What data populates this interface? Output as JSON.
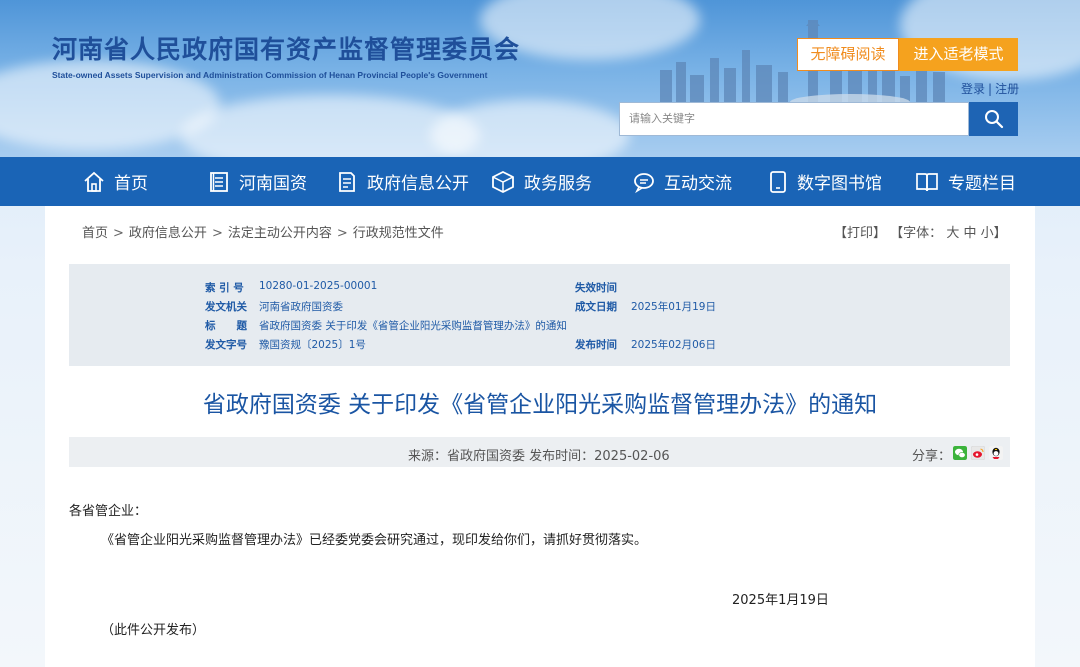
{
  "header": {
    "title": "河南省人民政府国有资产监督管理委员会",
    "subtitle": "State-owned Assets Supervision and Administration Commission of Henan Provincial People's Government",
    "accessibility_label": "无障碍阅读",
    "elder_mode_label": "进入适老模式",
    "login_label": "登录",
    "register_label": "注册",
    "search_placeholder": "请输入关键字"
  },
  "nav": {
    "items": [
      {
        "label": "首页",
        "icon": "home-icon"
      },
      {
        "label": "河南国资",
        "icon": "building-icon"
      },
      {
        "label": "政府信息公开",
        "icon": "document-icon"
      },
      {
        "label": "政务服务",
        "icon": "cube-icon"
      },
      {
        "label": "互动交流",
        "icon": "chat-icon"
      },
      {
        "label": "数字图书馆",
        "icon": "phone-icon"
      },
      {
        "label": "专题栏目",
        "icon": "book-icon"
      }
    ]
  },
  "breadcrumb": {
    "items": [
      "首页",
      "政府信息公开",
      "法定主动公开内容",
      "行政规范性文件"
    ],
    "separator": ">"
  },
  "tools": {
    "print": "【打印】",
    "font_prefix": "【字体：",
    "font_large": "大",
    "font_medium": "中",
    "font_small": "小",
    "font_suffix": "】"
  },
  "info": {
    "index_label": "索 引 号",
    "index_value": "10280-01-2025-00001",
    "expiry_label": "失效时间",
    "expiry_value": "",
    "issuer_label": "发文机关",
    "issuer_value": "河南省政府国资委",
    "written_date_label": "成文日期",
    "written_date_value": "2025年01月19日",
    "title_label": "标　　题",
    "title_value": "省政府国资委 关于印发《省管企业阳光采购监督管理办法》的通知",
    "doc_number_label": "发文字号",
    "doc_number_value": "豫国资规〔2025〕1号",
    "publish_date_label": "发布时间",
    "publish_date_value": "2025年02月06日"
  },
  "article": {
    "title": "省政府国资委 关于印发《省管企业阳光采购监督管理办法》的通知",
    "meta": "来源：省政府国资委 发布时间：2025-02-06",
    "share_label": "分享：",
    "salutation": "各省管企业：",
    "paragraph": "《省管企业阳光采购监督管理办法》已经委党委会研究通过，现印发给你们，请抓好贯彻落实。",
    "date": "2025年1月19日",
    "note": "（此件公开发布）"
  },
  "colors": {
    "nav_bg": "#1a64b6",
    "accent_orange": "#f5a21e",
    "title_blue": "#1a55a3"
  }
}
